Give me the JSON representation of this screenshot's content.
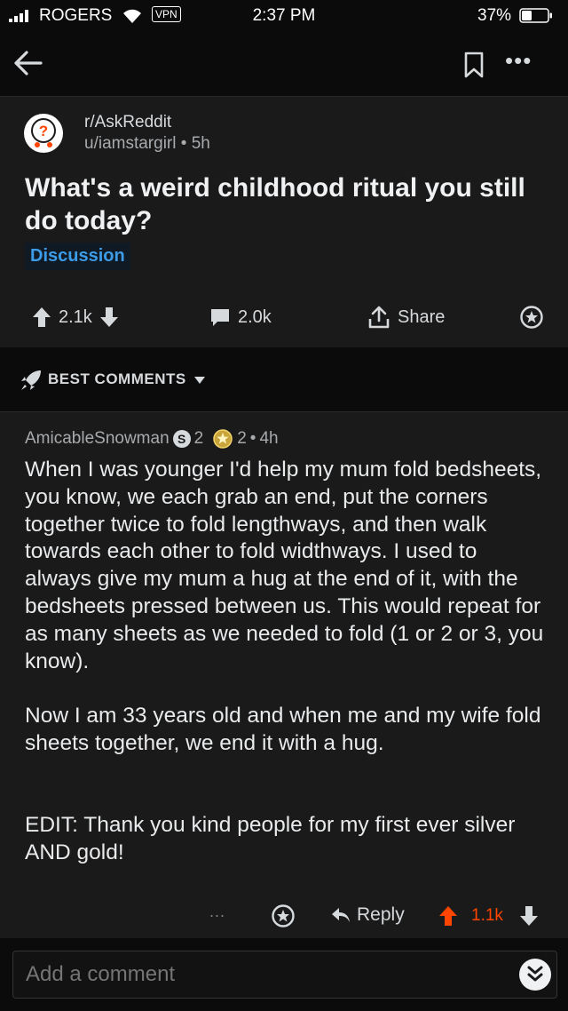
{
  "status_bar": {
    "carrier": "ROGERS",
    "vpn": "VPN",
    "time": "2:37 PM",
    "battery": "37%"
  },
  "post": {
    "subreddit": "r/AskReddit",
    "author": "u/iamstargirl",
    "age": "5h",
    "title": "What's a weird childhood ritual you still do today?",
    "flair": "Discussion",
    "upvotes": "2.1k",
    "comments": "2.0k",
    "share_label": "Share"
  },
  "sort": {
    "label": "BEST COMMENTS"
  },
  "comment": {
    "author": "AmicableSnowman",
    "silver_count": "2",
    "gold_count": "2",
    "age": "4h",
    "paragraphs": [
      "When I was younger I'd help my mum fold bedsheets, you know, we each grab an end, put the corners together twice to fold lengthways, and then walk towards each other to fold widthways. I used to always give my mum a hug at the end of it, with the bedsheets pressed between us. This would repeat for as many sheets as we needed to fold (1 or 2 or 3, you know).",
      "Now I am 33 years old and when me and my wife fold sheets together, we end it with a hug.",
      "EDIT: Thank you kind people for my first ever silver AND gold!"
    ],
    "more_label": "...",
    "reply_label": "Reply",
    "score": "1.1k"
  },
  "composer": {
    "placeholder": "Add a comment"
  },
  "colors": {
    "upvote": "#ff4500",
    "flair_text": "#3d9ce8",
    "background": "#1a1a1b"
  },
  "icons": [
    "signal-icon",
    "wifi-icon",
    "battery-icon",
    "back-arrow-icon",
    "bookmark-icon",
    "more-icon",
    "subreddit-icon",
    "upvote-icon",
    "downvote-icon",
    "comment-icon",
    "share-icon",
    "award-icon",
    "rocket-icon",
    "caret-down-icon",
    "silver-award-icon",
    "gold-award-icon",
    "reply-icon",
    "chevrons-down-icon"
  ]
}
